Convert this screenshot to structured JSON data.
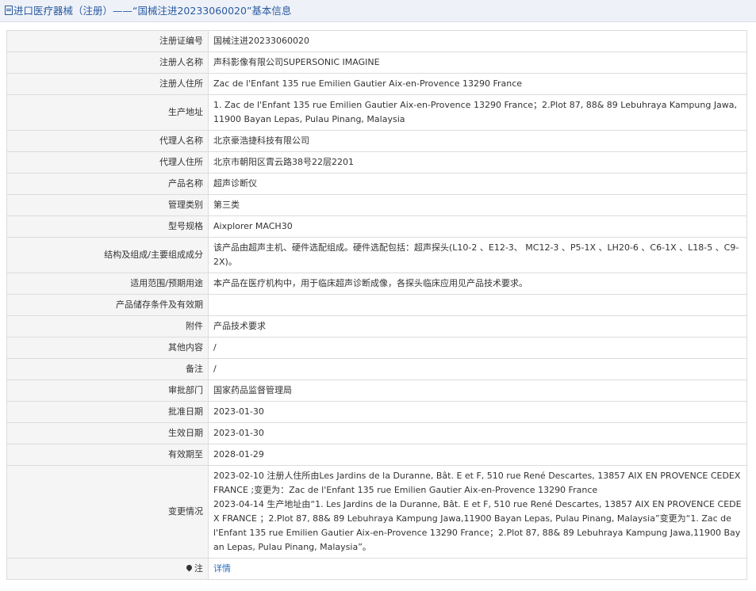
{
  "header": {
    "title": "进口医疗器械（注册）——“国械注进20233060020”基本信息"
  },
  "rows": [
    {
      "label": "注册证编号",
      "value": "国械注进20233060020"
    },
    {
      "label": "注册人名称",
      "value": "声科影像有限公司SUPERSONIC IMAGINE"
    },
    {
      "label": "注册人住所",
      "value": "Zac de l'Enfant 135 rue Emilien Gautier Aix-en-Provence 13290 France"
    },
    {
      "label": "生产地址",
      "value": "1. Zac de l'Enfant 135 rue Emilien Gautier Aix-en-Provence 13290 France；2.Plot 87, 88& 89 Lebuhraya Kampung Jawa,11900 Bayan Lepas, Pulau Pinang, Malaysia"
    },
    {
      "label": "代理人名称",
      "value": "北京豪浩捷科技有限公司"
    },
    {
      "label": "代理人住所",
      "value": "北京市朝阳区霄云路38号22层2201"
    },
    {
      "label": "产品名称",
      "value": "超声诊断仪"
    },
    {
      "label": "管理类别",
      "value": "第三类"
    },
    {
      "label": "型号规格",
      "value": "Aixplorer MACH30"
    },
    {
      "label": "结构及组成/主要组成成分",
      "value": "该产品由超声主机、硬件选配组成。硬件选配包括：超声探头(L10-2 、E12-3、 MC12-3 、P5-1X 、LH20-6 、C6-1X 、L18-5 、C9-2X)。"
    },
    {
      "label": "适用范围/预期用途",
      "value": "本产品在医疗机构中，用于临床超声诊断成像，各探头临床应用见产品技术要求。"
    },
    {
      "label": "产品储存条件及有效期",
      "value": ""
    },
    {
      "label": "附件",
      "value": "产品技术要求"
    },
    {
      "label": "其他内容",
      "value": "/"
    },
    {
      "label": "备注",
      "value": "/"
    },
    {
      "label": "审批部门",
      "value": "国家药品监督管理局"
    },
    {
      "label": "批准日期",
      "value": "2023-01-30"
    },
    {
      "label": "生效日期",
      "value": "2023-01-30"
    },
    {
      "label": "有效期至",
      "value": "2028-01-29"
    }
  ],
  "changes": {
    "label": "变更情况",
    "entries": [
      "2023-02-10 注册人住所由Les Jardins de la Duranne, Bât. E et F, 510 rue René Descartes, 13857 AIX EN PROVENCE CEDEX FRANCE ;变更为：Zac de l'Enfant 135 rue Emilien Gautier Aix-en-Provence 13290 France",
      "2023-04-14 生产地址由“1. Les Jardins de la Duranne, Bât. E et F, 510 rue René Descartes, 13857 AIX EN PROVENCE CEDEX FRANCE ；2.Plot 87, 88& 89 Lebuhraya Kampung Jawa,11900 Bayan Lepas, Pulau Pinang, Malaysia”变更为“1. Zac de l'Enfant 135 rue Emilien Gautier Aix-en-Provence 13290 France；2.Plot 87, 88& 89 Lebuhraya Kampung Jawa,11900 Bayan Lepas, Pulau Pinang, Malaysia”。"
    ]
  },
  "note_row": {
    "label": "注",
    "link_text": "详情",
    "icon": "pin-icon"
  }
}
